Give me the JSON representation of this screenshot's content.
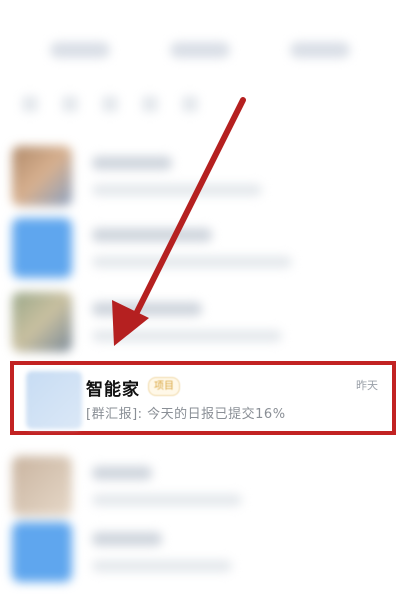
{
  "chat_item": {
    "name": "智能家",
    "badge": "项目",
    "time": "昨天",
    "preview": "[群汇报]: 今天的日报已提交16%"
  },
  "colors": {
    "highlight_border": "#c22222",
    "arrow": "#b52020",
    "badge_text": "#d9a640",
    "avatar_blue": "#5fa6ee"
  }
}
